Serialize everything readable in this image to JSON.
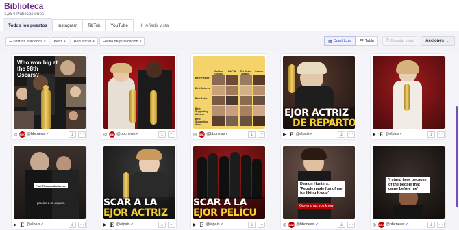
{
  "header": {
    "title": "Biblioteca",
    "subtitle": "1,354 Publicaciones"
  },
  "tabs": [
    {
      "label": "Todos los puestos",
      "active": true
    },
    {
      "label": "Instagram",
      "active": false
    },
    {
      "label": "TikTok",
      "active": false
    },
    {
      "label": "YouTube",
      "active": false
    }
  ],
  "add_view_label": "Añadir vista",
  "filters": [
    {
      "label": "0 filtros aplicados"
    },
    {
      "label": "Perfil"
    },
    {
      "label": "Red social"
    },
    {
      "label": "Fecha de publicación"
    }
  ],
  "views": {
    "grid_label": "Cuadrícula",
    "table_label": "Tabla"
  },
  "save_view_label": "Guardar vista",
  "actions_label": "Acciones",
  "cards": [
    {
      "platform": "instagram",
      "handle": "@bbcnews",
      "verified": true,
      "overlay": "Who won big at the 98th Oscars?",
      "icon": "instagram-icon"
    },
    {
      "platform": "instagram",
      "handle": "@bbcnews",
      "verified": true,
      "overlay": "",
      "icon": "instagram-icon"
    },
    {
      "platform": "instagram",
      "handle": "@bbcnews",
      "verified": true,
      "overlay": "",
      "icon": "instagram-icon"
    },
    {
      "platform": "youtube",
      "handle": "@elpais",
      "verified": true,
      "overlay": "EJOR ACTRIZ DE REPARTO",
      "icon": "youtube-icon"
    },
    {
      "platform": "youtube",
      "handle": "@elpais",
      "verified": true,
      "overlay": "",
      "icon": "youtube-icon"
    },
    {
      "platform": "youtube",
      "handle": "@elpais",
      "verified": true,
      "overlay": "gracias a mi reparto.",
      "icon": "youtube-icon"
    },
    {
      "platform": "youtube",
      "handle": "@elpais",
      "verified": true,
      "overlay": "SCAR A LA EJOR ACTRIZ",
      "icon": "youtube-icon"
    },
    {
      "platform": "youtube",
      "handle": "@elpais",
      "verified": true,
      "overlay": "SCAR A LA EJOR PELÍCU",
      "icon": "youtube-icon"
    },
    {
      "platform": "instagram",
      "handle": "@bbcnews",
      "verified": true,
      "overlay": "Demon Hunters: 'People made fun of me for liking K-pop'",
      "icon": "instagram-icon"
    },
    {
      "platform": "instagram",
      "handle": "@bbcnews",
      "verified": true,
      "overlay": "'I stand here because of the people that came before me'",
      "icon": "instagram-icon"
    }
  ],
  "thumb_labels": {
    "c1_title": "Who won big at the 98th Oscars?",
    "c3_headers": [
      "Golden Globes",
      "BAFTA",
      "The Actor Awards",
      "Oscars"
    ],
    "c3_rows": [
      "Best Picture",
      "Best Actress",
      "Best Actor",
      "Best Supporting Actress",
      "Best Supporting Actor"
    ],
    "c4_line1": "EJOR ACTRIZ",
    "c4_line2": "DE REPARTO",
    "c6_name": "Paul Thomas Anderson",
    "c6_caption": "gracias a mi reparto.",
    "c7_line1": "SCAR A LA",
    "c7_line2": "EJOR ACTRIZ",
    "c8_line1": "SCAR A LA",
    "c8_line2": "EJOR PELÍCU",
    "c9_title": "Demon Hunters: 'People made fun of me for liking K-pop'",
    "c9_caption": "Growing up, you know",
    "c10_quote": "'I stand here because of the people that came before me'"
  },
  "colors": {
    "brand": "#6a2c8a",
    "accent": "#3d4fb5",
    "scrollbar": "#7a4fb0",
    "bbc_red": "#b80000",
    "elpais": "#111111"
  }
}
